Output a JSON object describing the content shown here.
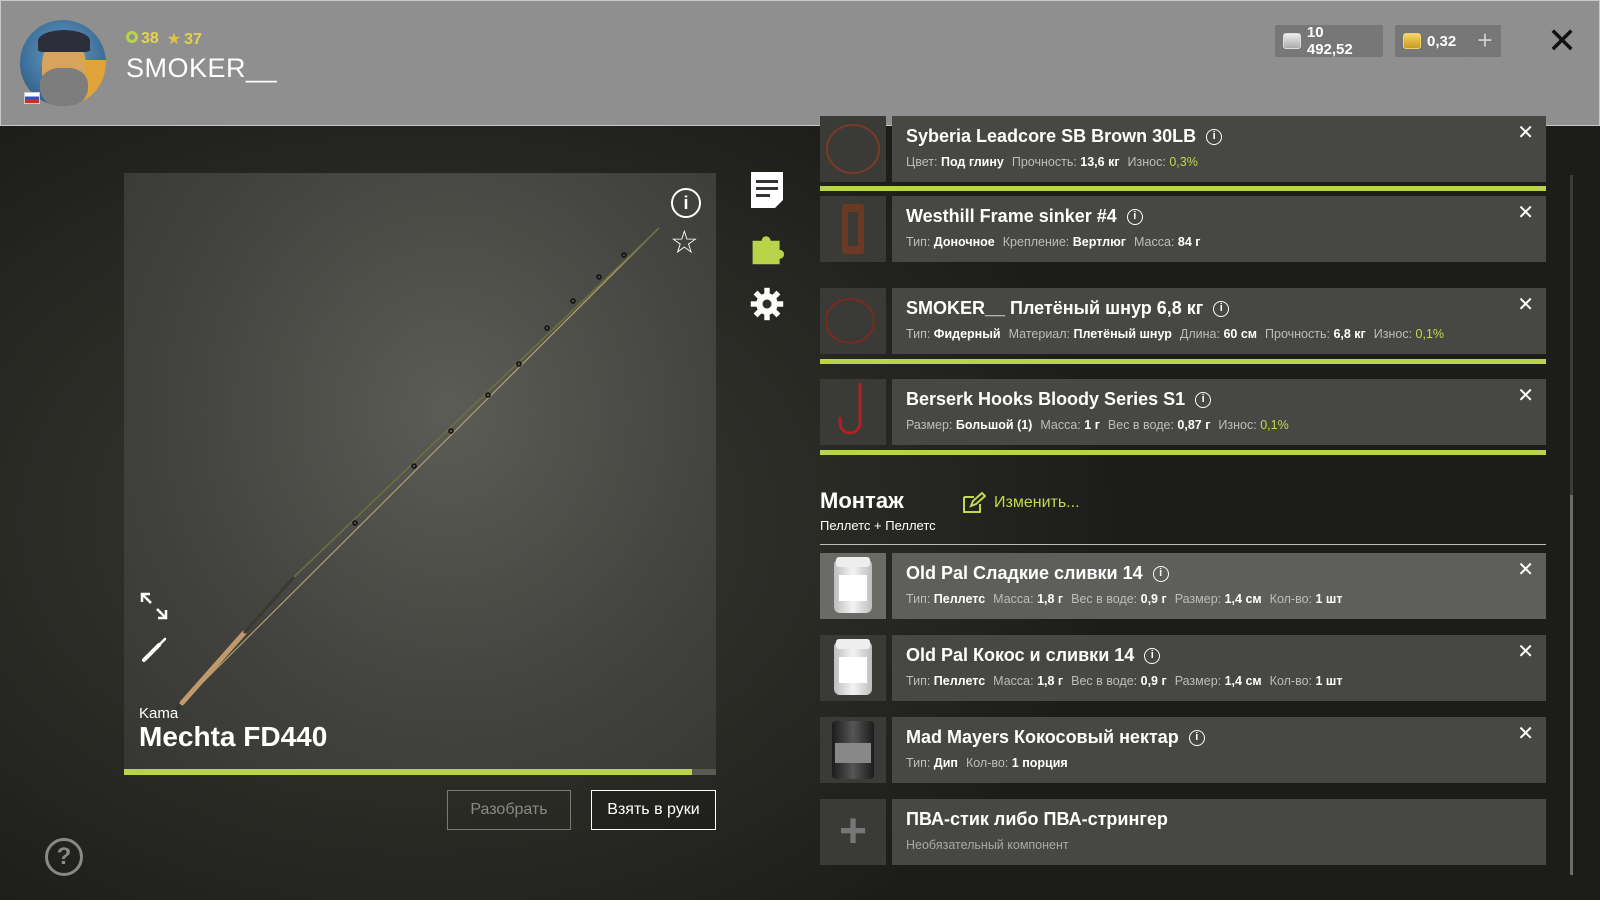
{
  "header": {
    "level": "38",
    "stars": "37",
    "username": "SMOKER__",
    "silver": "10 492,52",
    "gold": "0,32",
    "plus": "+",
    "close": "✕"
  },
  "rod": {
    "brand": "Kama",
    "name": "Mechta FD440",
    "condition": 0.96,
    "disassemble_label": "Разобрать",
    "take_label": "Взять в руки"
  },
  "items": [
    {
      "title": "Syberia Leadcore SB Brown 30LB",
      "props": [
        {
          "k": "Цвет:",
          "v": "Под глину"
        },
        {
          "k": "Прочность:",
          "v": "13,6 кг"
        },
        {
          "k": "Износ:",
          "v": "0,3%",
          "good": true
        }
      ]
    },
    {
      "title": "Westhill Frame sinker #4",
      "props": [
        {
          "k": "Тип:",
          "v": "Доночное"
        },
        {
          "k": "Крепление:",
          "v": "Вертлюг"
        },
        {
          "k": "Масса:",
          "v": "84 г"
        }
      ]
    },
    {
      "title": "SMOKER__ Плетёный шнур 6,8 кг",
      "props": [
        {
          "k": "Тип:",
          "v": "Фидерный"
        },
        {
          "k": "Материал:",
          "v": "Плетёный шнур"
        },
        {
          "k": "Длина:",
          "v": "60 см"
        },
        {
          "k": "Прочность:",
          "v": "6,8 кг"
        },
        {
          "k": "Износ:",
          "v": "0,1%",
          "good": true
        }
      ]
    },
    {
      "title": "Berserk Hooks Bloody Series S1",
      "props": [
        {
          "k": "Размер:",
          "v": "Большой (1)"
        },
        {
          "k": "Масса:",
          "v": "1 г"
        },
        {
          "k": "Вес в воде:",
          "v": "0,87 г"
        },
        {
          "k": "Износ:",
          "v": "0,1%",
          "good": true
        }
      ]
    }
  ],
  "rig": {
    "title": "Монтаж",
    "edit": "Изменить...",
    "subtitle": "Пеллетс + Пеллетс"
  },
  "baits": [
    {
      "title": "Old Pal Сладкие сливки 14",
      "props": [
        {
          "k": "Тип:",
          "v": "Пеллетс"
        },
        {
          "k": "Масса:",
          "v": "1,8 г"
        },
        {
          "k": "Вес в воде:",
          "v": "0,9 г"
        },
        {
          "k": "Размер:",
          "v": "1,4 см"
        },
        {
          "k": "Кол-во:",
          "v": "1 шт"
        }
      ]
    },
    {
      "title": "Old Pal Кокос и сливки 14",
      "props": [
        {
          "k": "Тип:",
          "v": "Пеллетс"
        },
        {
          "k": "Масса:",
          "v": "1,8 г"
        },
        {
          "k": "Вес в воде:",
          "v": "0,9 г"
        },
        {
          "k": "Размер:",
          "v": "1,4 см"
        },
        {
          "k": "Кол-во:",
          "v": "1 шт"
        }
      ]
    },
    {
      "title": "Mad Mayers Кокосовый нектар",
      "props": [
        {
          "k": "Тип:",
          "v": "Дип"
        },
        {
          "k": "Кол-во:",
          "v": "1 порция"
        }
      ]
    }
  ],
  "optional": {
    "title": "ПВА-стик либо ПВА-стрингер",
    "subtitle": "Необязательный компонент"
  },
  "colors": {
    "accent": "#b9d44a",
    "header_bg": "#8f8f8f"
  }
}
